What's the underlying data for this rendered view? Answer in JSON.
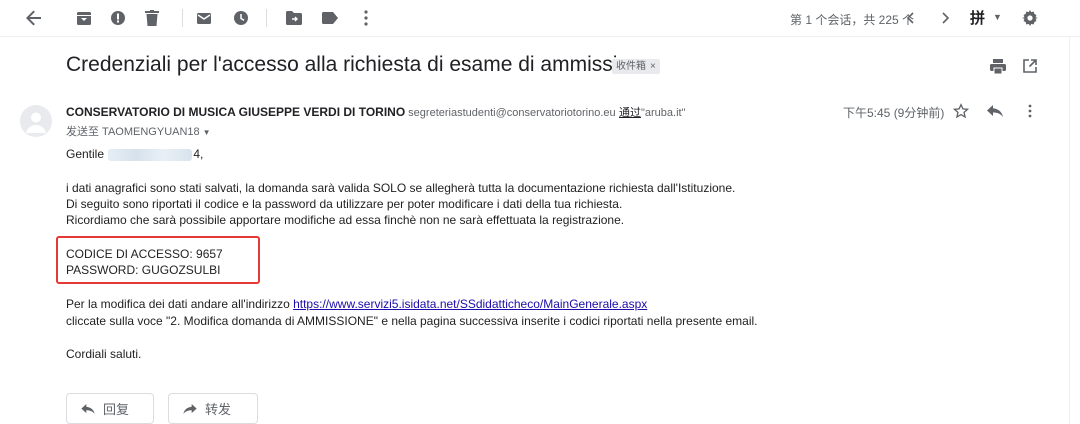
{
  "toolbar": {
    "pager": "第 1 个会话，共 225 个",
    "ime": "拼"
  },
  "email": {
    "subject": "Credenziali per l'accesso alla richiesta di esame di ammissione",
    "label": "收件箱",
    "label_close": "×",
    "sender_name": "CONSERVATORIO DI MUSICA GIUSEPPE VERDI DI TORINO",
    "sender_email": "segreteriastudenti@conservatoriotorino.eu",
    "via_label": "通过",
    "via_domain": "\"aruba.it\"",
    "recipient": "发送至 TAOMENGYUAN18",
    "time": "下午5:45 (9分钟前)"
  },
  "body": {
    "greeting_prefix": "Gentile",
    "greeting_suffix": "4,",
    "p1": "i dati anagrafici sono stati salvati, la domanda sarà valida SOLO se allegherà tutta la documentazione richiesta dall'Istituzione.",
    "p2": "Di seguito sono riportati il codice e la password da utilizzare per poter modificare i dati della tua richiesta.",
    "p3": "Ricordiamo che sarà possibile apportare modifiche ad essa finchè non ne sarà effettuata la registrazione.",
    "code": "CODICE DI ACCESSO: 9657",
    "password": "PASSWORD: GUGOZSULBI",
    "mod_prefix": "Per la modifica dei dati andare all'indirizzo",
    "mod_link": "https://www.servizi5.isidata.net/SSdidatticheco/MainGenerale.aspx",
    "instructions": "cliccate sulla voce \"2. Modifica domanda di AMMISSIONE\" e nella pagina successiva inserite i codici riportati nella presente email.",
    "closing": "Cordiali saluti."
  },
  "actions": {
    "reply": "回复",
    "forward": "转发"
  }
}
